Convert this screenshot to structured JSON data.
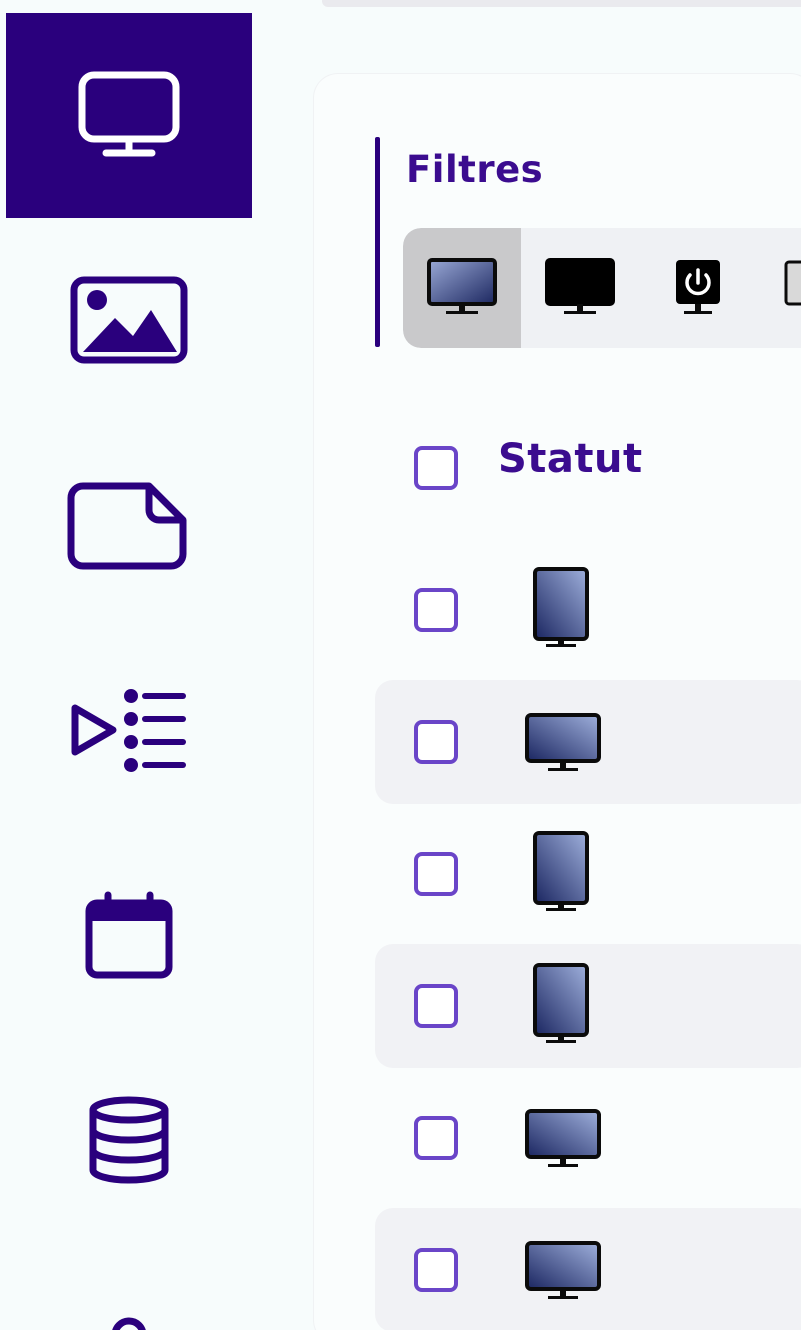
{
  "sidebar": {
    "items": [
      {
        "icon": "monitor-icon",
        "active": true
      },
      {
        "icon": "image-icon",
        "active": false
      },
      {
        "icon": "file-icon",
        "active": false
      },
      {
        "icon": "playlist-icon",
        "active": false
      },
      {
        "icon": "calendar-icon",
        "active": false
      },
      {
        "icon": "database-icon",
        "active": false
      },
      {
        "icon": "users-icon",
        "active": false
      }
    ]
  },
  "filters": {
    "title": "Filtres",
    "buttons": [
      {
        "icon": "monitor-status-all-icon",
        "selected": true
      },
      {
        "icon": "monitor-off-icon",
        "selected": false
      },
      {
        "icon": "monitor-power-icon",
        "selected": false
      },
      {
        "icon": "monitor-unknown-icon",
        "selected": false
      }
    ]
  },
  "table": {
    "header": "Statut",
    "rows": [
      {
        "orientation": "portrait",
        "checked": false
      },
      {
        "orientation": "landscape",
        "checked": false
      },
      {
        "orientation": "portrait",
        "checked": false
      },
      {
        "orientation": "portrait",
        "checked": false
      },
      {
        "orientation": "landscape",
        "checked": false
      },
      {
        "orientation": "landscape",
        "checked": false
      }
    ]
  },
  "colors": {
    "primary": "#2a007d",
    "accent": "#3b0c8f",
    "checkbox_border": "#6a45c8",
    "row_alt_bg": "#f1f2f5"
  }
}
